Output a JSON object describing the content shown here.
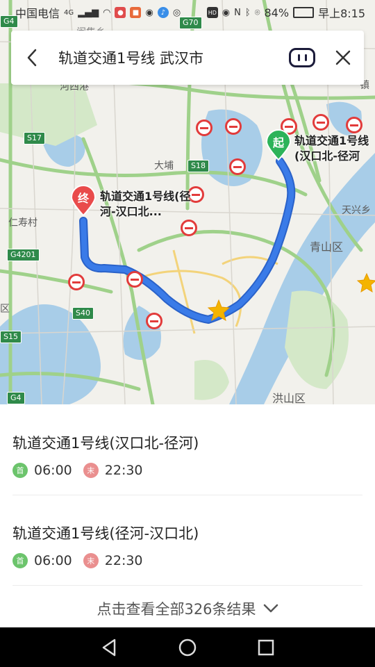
{
  "status_bar": {
    "carrier": "中国电信",
    "network": "4G",
    "battery": "84%",
    "time": "早上8:15"
  },
  "search": {
    "query": "轨道交通1号线 武汉市"
  },
  "map": {
    "labels": {
      "dapu": "大埔",
      "renshou": "仁寿村",
      "qingshan": "青山区",
      "tianxing": "天兴乡",
      "hongshan": "洪山区",
      "qu_left": "区",
      "zhen": "镇",
      "top_cut1": "闵集乡",
      "top_cut2": "河西港"
    },
    "shields": {
      "g70": "G70",
      "s17": "S17",
      "s18": "S18",
      "g4201": "G4201",
      "s40": "S40",
      "g4": "G4",
      "g4_top": "G4",
      "s15": "S15"
    },
    "route_end_label": "轨道交通1号线(径河-汉口北...",
    "route_start_label": "轨道交通1号线(汉口北-径河",
    "pin_end": "终",
    "pin_start": "起",
    "colors": {
      "route": "#3a7be8",
      "start_pin": "#2db35a",
      "end_pin": "#e94b4b",
      "water": "#a8cde8",
      "green_area": "#d4e8c8",
      "road_green": "#9fd18a"
    }
  },
  "results": [
    {
      "title": "轨道交通1号线(汉口北-径河)",
      "first_badge": "首",
      "first_time": "06:00",
      "last_badge": "末",
      "last_time": "22:30"
    },
    {
      "title": "轨道交通1号线(径河-汉口北)",
      "first_badge": "首",
      "first_time": "06:00",
      "last_badge": "末",
      "last_time": "22:30"
    }
  ],
  "more_text": "点击查看全部326条结果",
  "badge_colors": {
    "first": "#6cc46c",
    "last": "#ea8f8f"
  }
}
